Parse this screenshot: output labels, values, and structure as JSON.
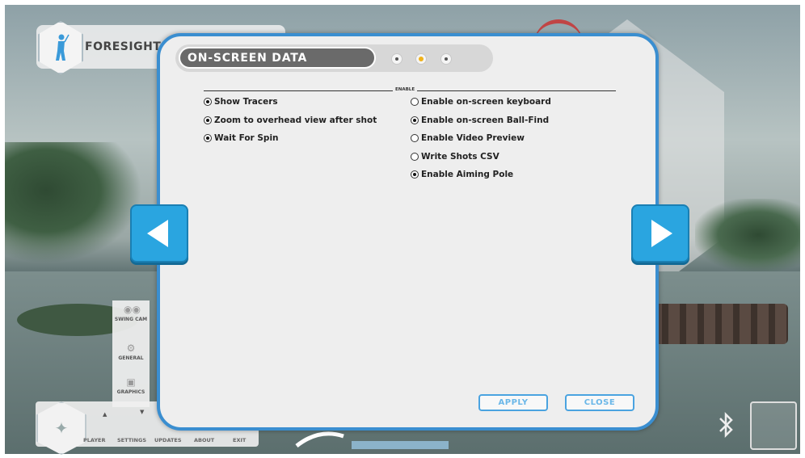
{
  "brand": {
    "name": "FORESIGHT",
    "icon": "golfer-icon"
  },
  "dialog": {
    "title": "ON-SCREEN DATA",
    "page_dots": [
      {
        "name": "page-dot-1",
        "active": false
      },
      {
        "name": "page-dot-2",
        "active": true
      },
      {
        "name": "page-dot-3",
        "active": false
      }
    ],
    "section_label": "ENABLE",
    "left_options": [
      {
        "label": "Show Tracers",
        "checked": true
      },
      {
        "label": "Zoom to overhead view after shot",
        "checked": true
      },
      {
        "label": "Wait For Spin",
        "checked": true
      }
    ],
    "right_options": [
      {
        "label": "Enable on-screen keyboard",
        "checked": false
      },
      {
        "label": "Enable on-screen Ball-Find",
        "checked": true
      },
      {
        "label": "Enable Video Preview",
        "checked": false
      },
      {
        "label": "Write Shots CSV",
        "checked": false
      },
      {
        "label": "Enable Aiming Pole",
        "checked": true
      }
    ],
    "apply_label": "APPLY",
    "close_label": "CLOSE"
  },
  "side_menu": {
    "items": [
      {
        "label": "SWING CAM",
        "icon": "camera-icon"
      },
      {
        "label": "GENERAL",
        "icon": "gears-icon"
      },
      {
        "label": "GRAPHICS",
        "icon": "image-icon"
      }
    ]
  },
  "bottom_bar": {
    "items": [
      "PLAYER",
      "SETTINGS",
      "UPDATES",
      "ABOUT",
      "EXIT"
    ]
  },
  "colors": {
    "accent": "#2aa5e0",
    "dialog_border": "#3a8ed0",
    "active_dot": "#f0b21c"
  }
}
